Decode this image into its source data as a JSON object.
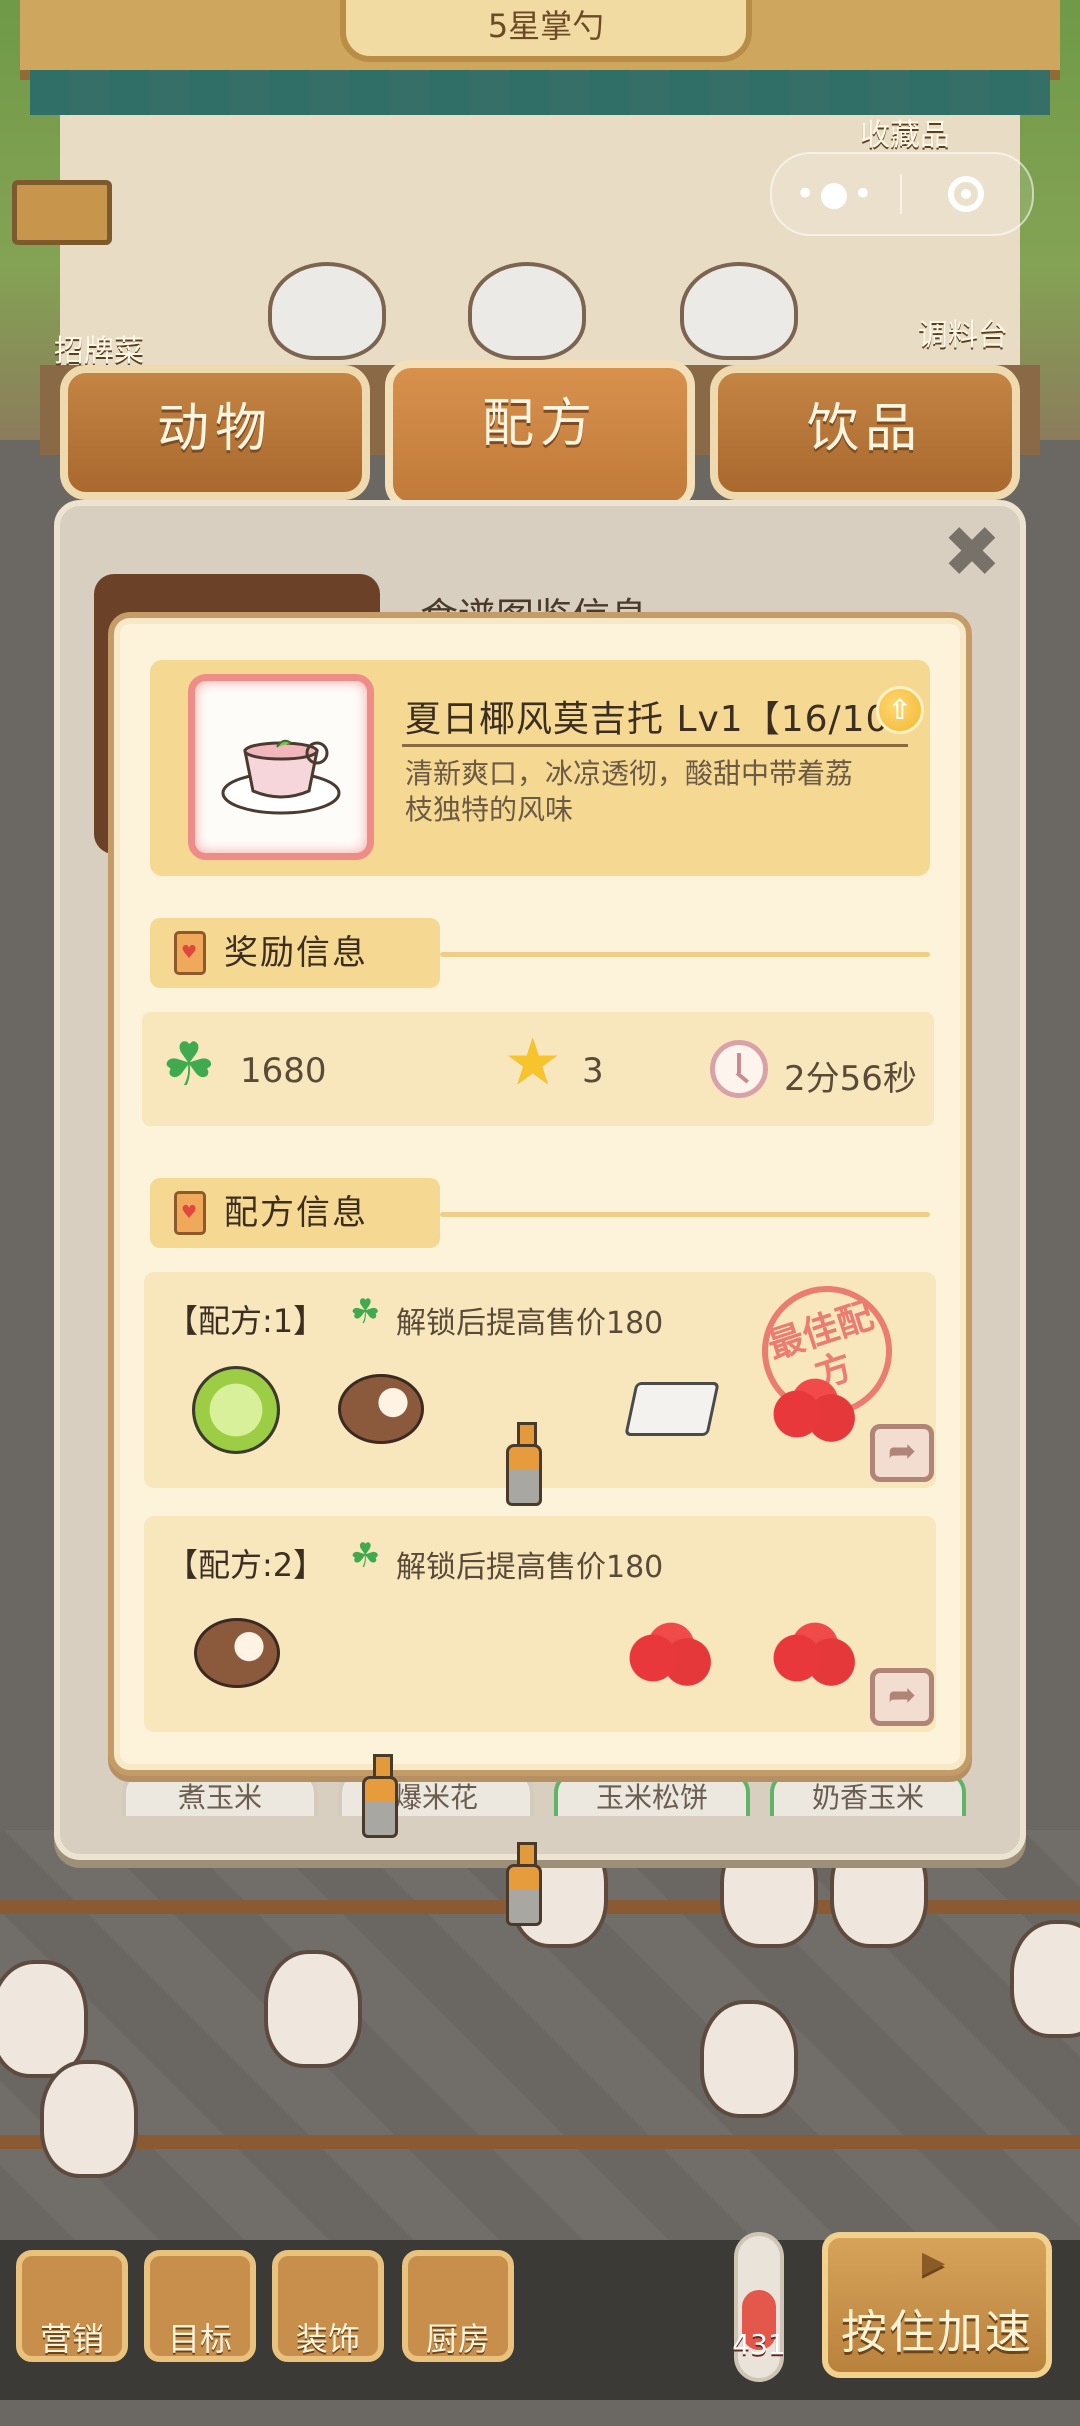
{
  "shop": {
    "rating_badge": "5星掌勺",
    "collection_label": "收藏品",
    "signature_label": "招牌菜",
    "seasoning_label": "调料台"
  },
  "wechat": {
    "more_icon": "more-dots-icon",
    "record_icon": "record-target-icon"
  },
  "tabs": [
    {
      "label": "动物",
      "active": false
    },
    {
      "label": "配方",
      "active": true
    },
    {
      "label": "饮品",
      "active": false
    }
  ],
  "background_panel": {
    "title": "食谱图鉴信息",
    "chips": [
      "煮玉米",
      "爆米花",
      "玉米松饼",
      "奶香玉米"
    ]
  },
  "dish": {
    "name": "夏日椰风莫吉托 Lv1【16/10",
    "description": "清新爽口，冰凉透彻，酸甜中带着荔枝独特的风味",
    "upgrade_icon": "upgrade-arrow-icon"
  },
  "reward_section": {
    "title": "奖励信息",
    "clover_value": "1680",
    "star_value": "3",
    "time_value": "2分56秒"
  },
  "recipe_section": {
    "title": "配方信息",
    "recipes": [
      {
        "name": "【配方:1】",
        "note": "解锁后提高售价180",
        "best_stamp": "最佳配方",
        "ingredients": [
          "lime-icon",
          "coconut-icon",
          "rum-bottle-icon",
          "tofu-icon",
          "lychee-icon"
        ]
      },
      {
        "name": "【配方:2】",
        "note": "解锁后提高售价180",
        "ingredients": [
          "coconut-icon",
          "rum-bottle-icon",
          "rum-bottle-icon",
          "lychee-icon",
          "lychee-icon"
        ]
      }
    ]
  },
  "bottom_bar": {
    "marketing": "营销",
    "goals": "目标",
    "decor": "装饰",
    "kitchen": "厨房",
    "temperature": "431",
    "speed_up": "按住加速"
  },
  "colors": {
    "popup_bg": "#fdf2da",
    "card_bg": "#f8e7bd",
    "header_bg": "#f5d993",
    "accent_tab": "#c48443",
    "clover": "#3faa4f",
    "stamp_red": "#e86a66"
  }
}
